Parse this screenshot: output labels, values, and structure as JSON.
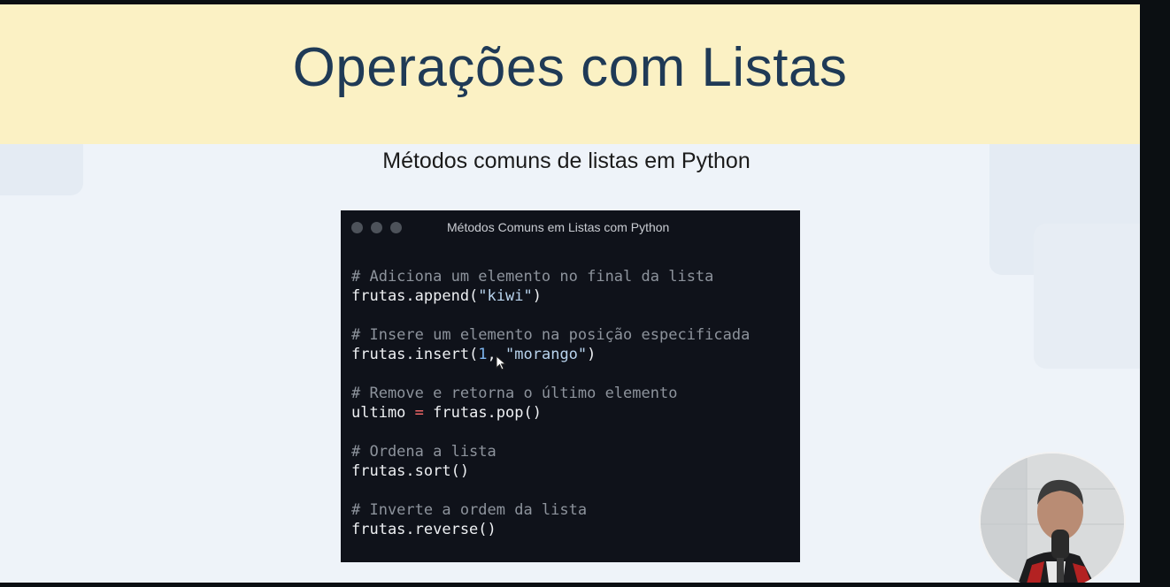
{
  "slide": {
    "title": "Operações com Listas",
    "subtitle": "Métodos comuns de listas em Python"
  },
  "code_window": {
    "title": "Métodos Comuns em Listas com Python",
    "blocks": [
      {
        "comment": "# Adiciona um elemento no final da lista",
        "code_prefix": "frutas.append(",
        "code_str": "\"kiwi\"",
        "code_suffix": ")"
      },
      {
        "comment": "# Insere um elemento na posição especificada",
        "code_prefix": "frutas.insert(",
        "code_num": "1",
        "code_sep": ", ",
        "code_str": "\"morango\"",
        "code_suffix": ")"
      },
      {
        "comment": "# Remove e retorna o último elemento",
        "code_prefix": "ultimo ",
        "code_op": "=",
        "code_suffix": " frutas.pop()"
      },
      {
        "comment": "# Ordena a lista",
        "code": "frutas.sort()"
      },
      {
        "comment": "# Inverte a ordem da lista",
        "code": "frutas.reverse()"
      }
    ]
  },
  "webcam": {
    "icon": "presenter-avatar"
  },
  "colors": {
    "banner": "#fbf1c4",
    "title": "#1f3a56",
    "code_bg": "#0f121a",
    "comment": "#8d939c",
    "string": "#b9d4ee",
    "operator": "#ff6d6d"
  }
}
